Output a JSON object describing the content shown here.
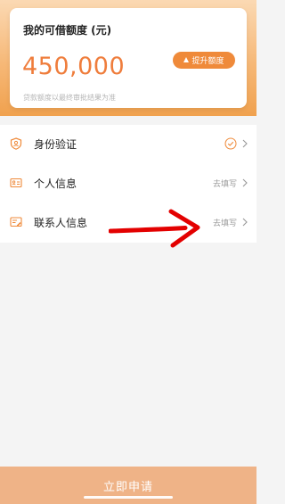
{
  "card": {
    "title": "我的可借额度 (元)",
    "amount": "450,000",
    "raise_button_label": "提升额度",
    "note": "贷款额度以最终审批结果为准"
  },
  "rows": [
    {
      "label": "身份验证",
      "status": "",
      "icon": "shield-person-icon"
    },
    {
      "label": "个人信息",
      "status": "去填写",
      "icon": "id-card-icon"
    },
    {
      "label": "联系人信息",
      "status": "去填写",
      "icon": "contact-edit-icon"
    }
  ],
  "apply_button_label": "立即申请",
  "colors": {
    "accent": "#ef7d3c",
    "annotation_arrow": "#e30000"
  }
}
